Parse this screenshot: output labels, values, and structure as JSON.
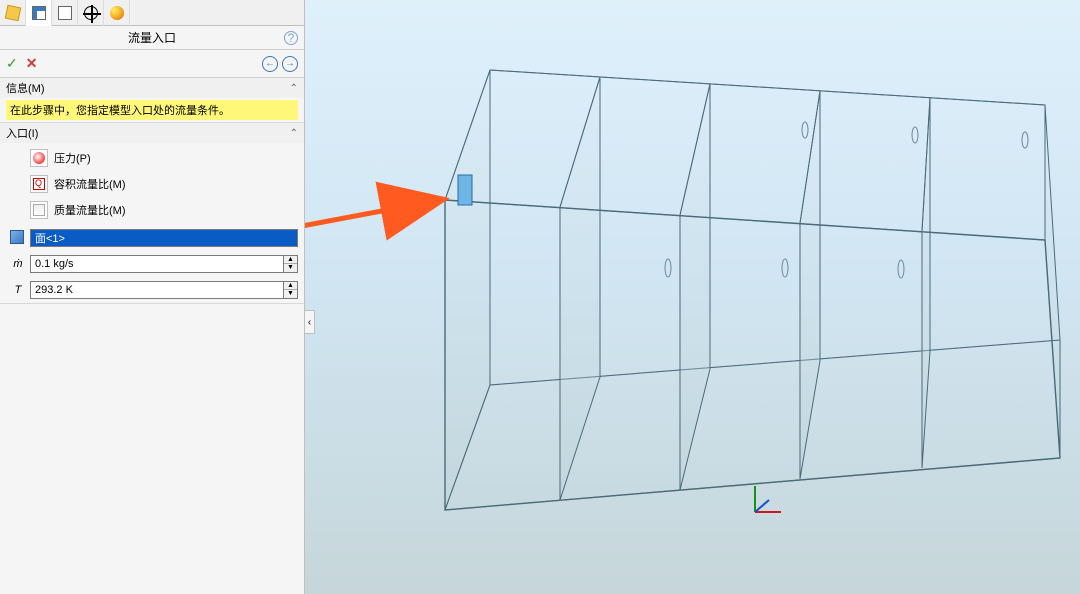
{
  "panel": {
    "title": "流量入口",
    "help_tooltip": "?"
  },
  "actions": {
    "ok": "✓",
    "cancel": "✕",
    "prev": "←",
    "next": "→"
  },
  "sections": {
    "info": {
      "header": "信息(M)",
      "message": "在此步骤中，您指定模型入口处的流量条件。"
    },
    "inlet": {
      "header": "入口(I)",
      "pressure": "压力(P)",
      "vol_flow": "容积流量比(M)",
      "mass_flow": "质量流量比(M)"
    }
  },
  "fields": {
    "selected_face": "面<1>",
    "mass_flow_rate": {
      "label": "ṁ",
      "value": "0.1 kg/s"
    },
    "temperature": {
      "label": "T",
      "value": "293.2 K"
    }
  },
  "viewport": {
    "side_toggle": "‹"
  },
  "icons": {
    "tab_feature": "feature-manager-icon",
    "tab_property": "property-manager-icon",
    "tab_config": "configuration-manager-icon",
    "tab_dimxpert": "dimxpert-icon",
    "tab_render": "render-icon"
  }
}
